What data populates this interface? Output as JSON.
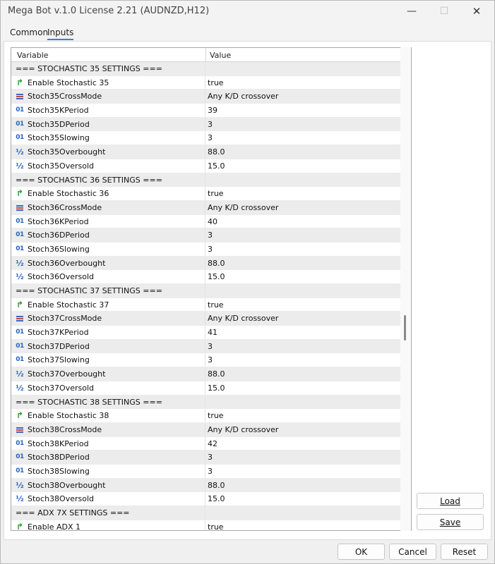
{
  "window": {
    "title": "Mega Bot v.1.0 License 2.21 (AUDNZD,H12)",
    "minimize_glyph": "—",
    "maximize_glyph": "☐",
    "close_glyph": "✕"
  },
  "tabs": [
    {
      "label": "Common",
      "active": false
    },
    {
      "label": "Inputs",
      "active": true
    }
  ],
  "grid": {
    "header_variable": "Variable",
    "header_value": "Value",
    "rows": [
      {
        "type": "section",
        "name": "=== STOCHASTIC 35 SETTINGS ===",
        "value": ""
      },
      {
        "type": "bool",
        "name": "Enable Stochastic 35",
        "value": "true"
      },
      {
        "type": "enum",
        "name": "Stoch35CrossMode",
        "value": "Any K/D crossover"
      },
      {
        "type": "int",
        "name": "Stoch35KPeriod",
        "value": "39"
      },
      {
        "type": "int",
        "name": "Stoch35DPeriod",
        "value": "3"
      },
      {
        "type": "int",
        "name": "Stoch35Slowing",
        "value": "3"
      },
      {
        "type": "double",
        "name": "Stoch35Overbought",
        "value": "88.0"
      },
      {
        "type": "double",
        "name": "Stoch35Oversold",
        "value": "15.0"
      },
      {
        "type": "section",
        "name": "=== STOCHASTIC 36 SETTINGS ===",
        "value": ""
      },
      {
        "type": "bool",
        "name": "Enable Stochastic 36",
        "value": "true"
      },
      {
        "type": "enum",
        "name": "Stoch36CrossMode",
        "value": "Any K/D crossover"
      },
      {
        "type": "int",
        "name": "Stoch36KPeriod",
        "value": "40"
      },
      {
        "type": "int",
        "name": "Stoch36DPeriod",
        "value": "3"
      },
      {
        "type": "int",
        "name": "Stoch36Slowing",
        "value": "3"
      },
      {
        "type": "double",
        "name": "Stoch36Overbought",
        "value": "88.0"
      },
      {
        "type": "double",
        "name": "Stoch36Oversold",
        "value": "15.0"
      },
      {
        "type": "section",
        "name": "=== STOCHASTIC 37 SETTINGS ===",
        "value": ""
      },
      {
        "type": "bool",
        "name": "Enable Stochastic 37",
        "value": "true"
      },
      {
        "type": "enum",
        "name": "Stoch37CrossMode",
        "value": "Any K/D crossover"
      },
      {
        "type": "int",
        "name": "Stoch37KPeriod",
        "value": "41"
      },
      {
        "type": "int",
        "name": "Stoch37DPeriod",
        "value": "3"
      },
      {
        "type": "int",
        "name": "Stoch37Slowing",
        "value": "3"
      },
      {
        "type": "double",
        "name": "Stoch37Overbought",
        "value": "88.0"
      },
      {
        "type": "double",
        "name": "Stoch37Oversold",
        "value": "15.0"
      },
      {
        "type": "section",
        "name": "=== STOCHASTIC 38 SETTINGS ===",
        "value": ""
      },
      {
        "type": "bool",
        "name": "Enable Stochastic 38",
        "value": "true"
      },
      {
        "type": "enum",
        "name": "Stoch38CrossMode",
        "value": "Any K/D crossover"
      },
      {
        "type": "int",
        "name": "Stoch38KPeriod",
        "value": "42"
      },
      {
        "type": "int",
        "name": "Stoch38DPeriod",
        "value": "3"
      },
      {
        "type": "int",
        "name": "Stoch38Slowing",
        "value": "3"
      },
      {
        "type": "double",
        "name": "Stoch38Overbought",
        "value": "88.0"
      },
      {
        "type": "double",
        "name": "Stoch38Oversold",
        "value": "15.0"
      },
      {
        "type": "section",
        "name": "=== ADX 7X SETTINGS ===",
        "value": ""
      },
      {
        "type": "bool",
        "name": "Enable ADX 1",
        "value": "true"
      }
    ]
  },
  "icons": {
    "bool": "bool-arrow-icon",
    "enum": "enum-list-icon",
    "int": "integer-icon",
    "double": "double-icon"
  },
  "icon_glyphs": {
    "int": "01",
    "double": "½",
    "bool": "↱"
  },
  "buttons": {
    "load": "Load",
    "save": "Save",
    "ok": "OK",
    "cancel": "Cancel",
    "reset": "Reset"
  }
}
